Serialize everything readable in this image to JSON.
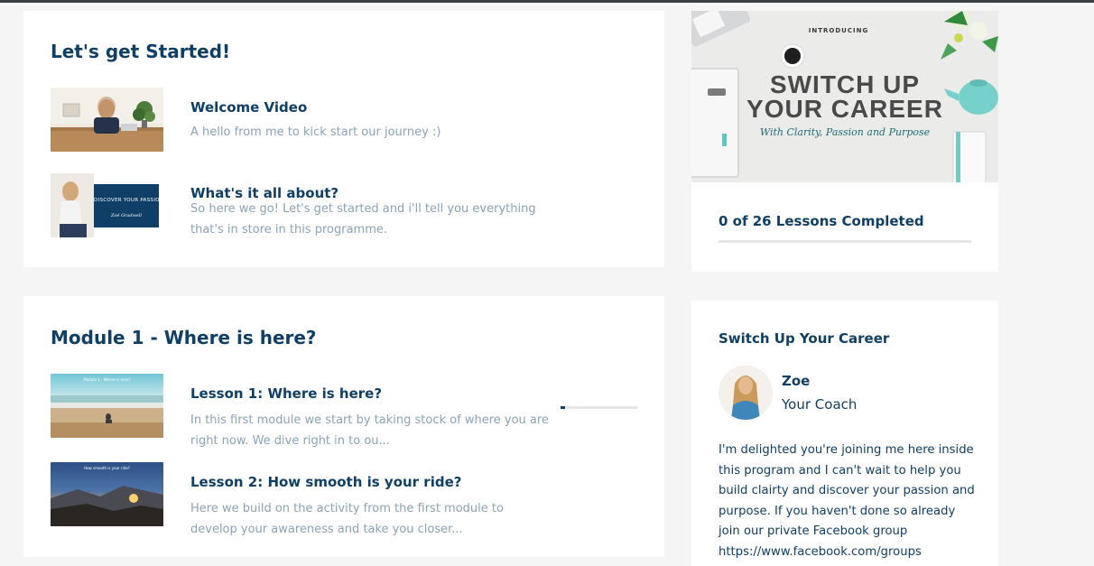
{
  "colors": {
    "accent": "#0f3f66",
    "muted_text": "#8aa3b5",
    "page_bg": "#f5f5f5",
    "card_bg": "#ffffff"
  },
  "section_intro": {
    "title": "Let's get Started!",
    "lessons": [
      {
        "title": "Welcome Video",
        "description": "A hello from me to kick start our journey :)"
      },
      {
        "title": "What's it all about?",
        "description": "So here we go! Let's get started and i'll tell you everything that's in store in this programme.",
        "thumb_caption": "DISCOVER YOUR PASSION",
        "thumb_signature": "Zoë Gradwell"
      }
    ]
  },
  "section_module1": {
    "title": "Module 1 - Where is here?",
    "lessons": [
      {
        "title": "Lesson 1: Where is here?",
        "description": "In this first module we start by taking stock of where you are right now. We dive right in to ou...",
        "progress": 0.06,
        "thumb_caption": "Module 1 - Where is here?"
      },
      {
        "title": "Lesson 2: How smooth is your ride?",
        "description": "Here we build on the activity from the first module to develop your awareness and take you closer...",
        "thumb_caption": "How smooth is your ride?"
      }
    ]
  },
  "course_banner": {
    "kicker": "INTRODUCING",
    "headline_line1": "SWITCH UP",
    "headline_line2": "YOUR CAREER",
    "tagline": "With Clarity, Passion and Purpose"
  },
  "progress_card": {
    "label": "0 of 26 Lessons Completed",
    "completed": 0,
    "total": 26
  },
  "coach_card": {
    "title": "Switch Up Your Career",
    "coach_name": "Zoe",
    "coach_role": "Your Coach",
    "message": "I'm delighted you're joining me here inside this program and I can't wait to help you build clairty and discover your passion and purpose. If you haven't done so already join our private Facebook group https://www.facebook.com/groups"
  }
}
